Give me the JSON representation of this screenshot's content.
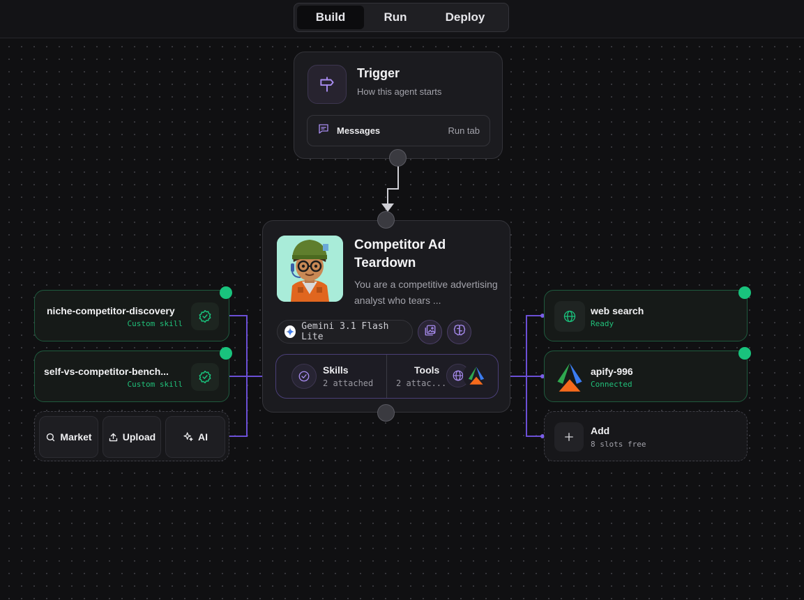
{
  "tabs": [
    {
      "label": "Build",
      "active": true
    },
    {
      "label": "Run",
      "active": false
    },
    {
      "label": "Deploy",
      "active": false
    }
  ],
  "trigger": {
    "title": "Trigger",
    "subtitle": "How this agent starts",
    "messages_label": "Messages",
    "messages_right": "Run tab",
    "icon": "signpost-icon"
  },
  "agent": {
    "title": "Competitor Ad Teardown",
    "description": "You are a competitive advertising analyst who tears ...",
    "model": "Gemini 3.1 Flash Lite",
    "skills": {
      "title": "Skills",
      "sub": "2 attached"
    },
    "tools": {
      "title": "Tools",
      "sub": "2 attac..."
    }
  },
  "skills": [
    {
      "name": "niche-competitor-discovery",
      "status": "Custom skill"
    },
    {
      "name": "self-vs-competitor-bench...",
      "status": "Custom skill"
    }
  ],
  "skill_actions": [
    {
      "label": "Market",
      "icon": "search-icon"
    },
    {
      "label": "Upload",
      "icon": "upload-icon"
    },
    {
      "label": "AI",
      "icon": "sparkle-icon"
    }
  ],
  "tools": [
    {
      "name": "web search",
      "status": "Ready",
      "icon": "globe-icon"
    },
    {
      "name": "apify-996",
      "status": "Connected",
      "icon": "apify-logo-icon"
    }
  ],
  "add_tool": {
    "label": "Add",
    "sub": "8 slots free"
  },
  "colors": {
    "accent_purple": "#6b4fd6",
    "status_green": "#19c37d",
    "background": "#101012"
  }
}
